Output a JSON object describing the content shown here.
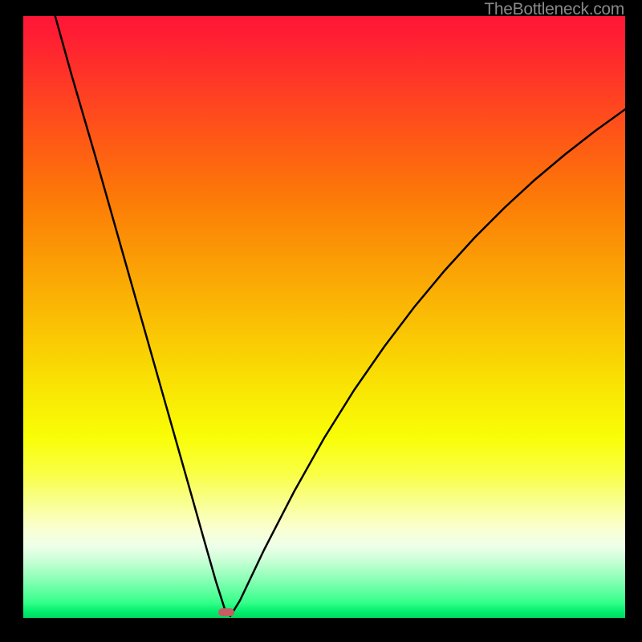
{
  "watermark": "TheBottleneck.com",
  "chart_data": {
    "type": "line",
    "title": "",
    "xlabel": "",
    "ylabel": "",
    "xlim": [
      0,
      100
    ],
    "ylim": [
      0,
      100
    ],
    "grid": false,
    "colors": {
      "top": "#ff1637",
      "mid": "#faed04",
      "bottom": "#00d860",
      "curve": "#000000",
      "marker": "#c45e63"
    },
    "marker": {
      "x": 33.7,
      "y": 0.9,
      "width_pct": 2.7,
      "height_pct": 1.3
    },
    "series": [
      {
        "name": "left-branch",
        "x": [
          5.3,
          8,
          12,
          16,
          20,
          24,
          28,
          30,
          32,
          33.5,
          34.4
        ],
        "y": [
          100,
          90.3,
          76.6,
          62.5,
          48.4,
          34.3,
          20.2,
          13.1,
          6.1,
          1.4,
          0.3
        ]
      },
      {
        "name": "right-branch",
        "x": [
          34.4,
          36,
          40,
          45,
          50,
          55,
          60,
          65,
          70,
          75,
          80,
          85,
          90,
          95,
          100
        ],
        "y": [
          0.3,
          2.9,
          11.3,
          21,
          29.9,
          37.9,
          45.1,
          51.7,
          57.7,
          63.2,
          68.2,
          72.8,
          77,
          80.9,
          84.5
        ]
      }
    ]
  }
}
